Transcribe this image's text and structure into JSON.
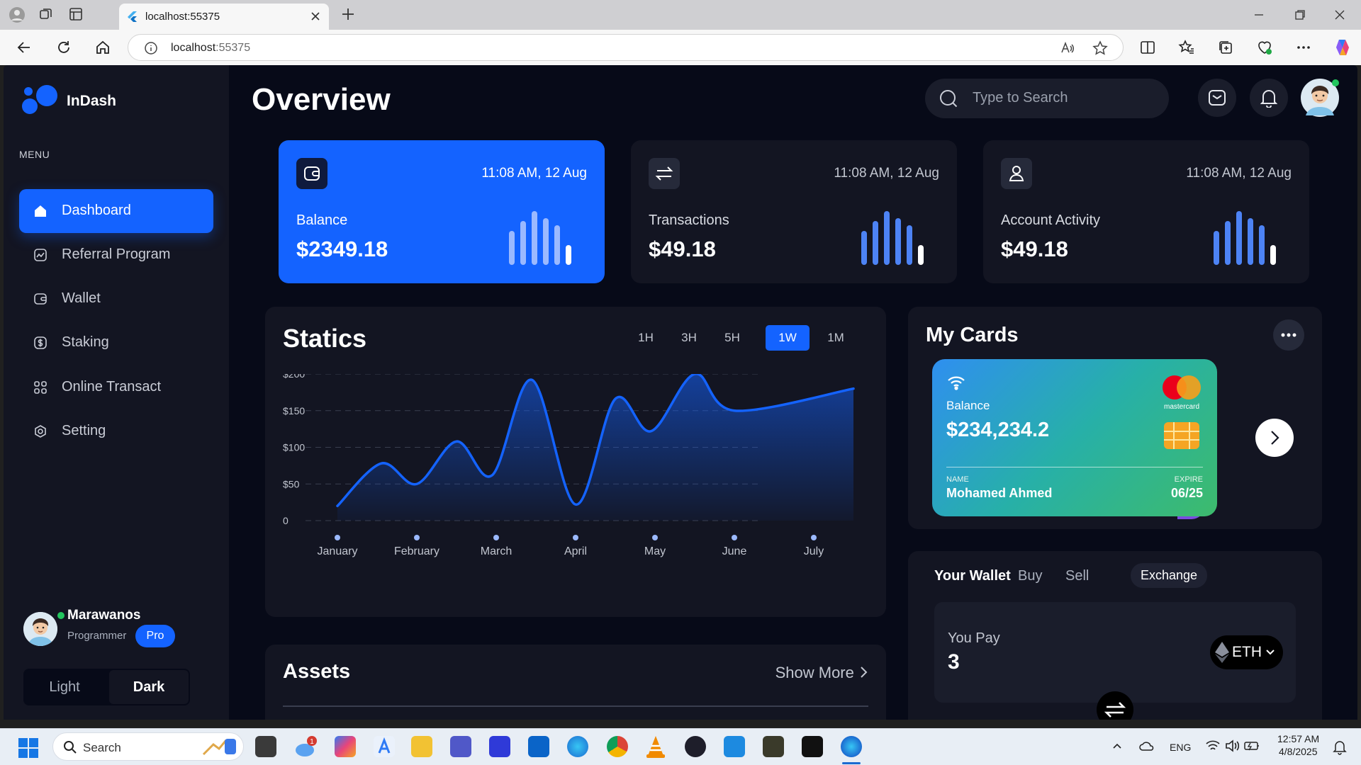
{
  "browser": {
    "tab_title": "localhost:55375",
    "url_host": "localhost",
    "url_port": ":55375"
  },
  "app": {
    "brand": "InDash",
    "menu_label": "MENU",
    "nav": [
      {
        "label": "Dashboard",
        "icon": "home-icon",
        "active": true
      },
      {
        "label": "Referral Program",
        "icon": "chart-icon",
        "active": false
      },
      {
        "label": "Wallet",
        "icon": "wallet-icon",
        "active": false
      },
      {
        "label": "Staking",
        "icon": "dollar-icon",
        "active": false
      },
      {
        "label": "Online Transact",
        "icon": "grid-icon",
        "active": false
      },
      {
        "label": "Setting",
        "icon": "gear-icon",
        "active": false
      }
    ],
    "user": {
      "name": "Marawanos",
      "role": "Programmer",
      "badge": "Pro"
    },
    "theme": {
      "light": "Light",
      "dark": "Dark",
      "selected": "Dark"
    }
  },
  "header": {
    "title": "Overview",
    "search_placeholder": "Type to Search"
  },
  "stats": [
    {
      "label": "Balance",
      "value": "$2349.18",
      "time": "11:08 AM, 12 Aug",
      "icon": "wallet-icon"
    },
    {
      "label": "Transactions",
      "value": "$49.18",
      "time": "11:08 AM, 12 Aug",
      "icon": "swap-icon"
    },
    {
      "label": "Account Activity",
      "value": "$49.18",
      "time": "11:08 AM, 12 Aug",
      "icon": "user-icon"
    }
  ],
  "statics": {
    "title": "Statics",
    "ranges": [
      "1H",
      "3H",
      "5H",
      "1W",
      "1M"
    ],
    "selected_range": "1W"
  },
  "chart_data": {
    "type": "area",
    "title": "Statics",
    "categories": [
      "January",
      "February",
      "March",
      "April",
      "May",
      "June",
      "July"
    ],
    "y_ticks": [
      "0",
      "$50",
      "$100",
      "$150",
      "$200"
    ],
    "ylim": [
      0,
      200
    ],
    "grid": true,
    "points": [
      {
        "x": 0.0,
        "y": 20
      },
      {
        "x": 0.55,
        "y": 78
      },
      {
        "x": 1.0,
        "y": 50
      },
      {
        "x": 1.5,
        "y": 108
      },
      {
        "x": 1.95,
        "y": 62
      },
      {
        "x": 2.45,
        "y": 192
      },
      {
        "x": 3.0,
        "y": 22
      },
      {
        "x": 3.5,
        "y": 166
      },
      {
        "x": 3.95,
        "y": 122
      },
      {
        "x": 4.5,
        "y": 200
      },
      {
        "x": 5.0,
        "y": 150
      },
      {
        "x": 6.5,
        "y": 180
      }
    ],
    "line_color": "#1463ff"
  },
  "cards": {
    "title": "My Cards",
    "card": {
      "balance_label": "Balance",
      "balance": "$234,234.2",
      "name_label": "NAME",
      "name": "Mohamed Ahmed",
      "expire_label": "EXPIRE",
      "expire": "06/25",
      "brand": "mastercard"
    }
  },
  "assets": {
    "title": "Assets",
    "show_more": "Show More"
  },
  "wallet": {
    "title": "Your Wallet",
    "tabs": [
      "Buy",
      "Sell",
      "Exchange"
    ],
    "selected_tab": "Exchange",
    "you_pay_label": "You Pay",
    "you_pay_value": "3",
    "currency": "ETH"
  },
  "taskbar": {
    "search": "Search",
    "language": "ENG",
    "time": "12:57 AM",
    "date": "4/8/2025",
    "notification_count": "1"
  }
}
